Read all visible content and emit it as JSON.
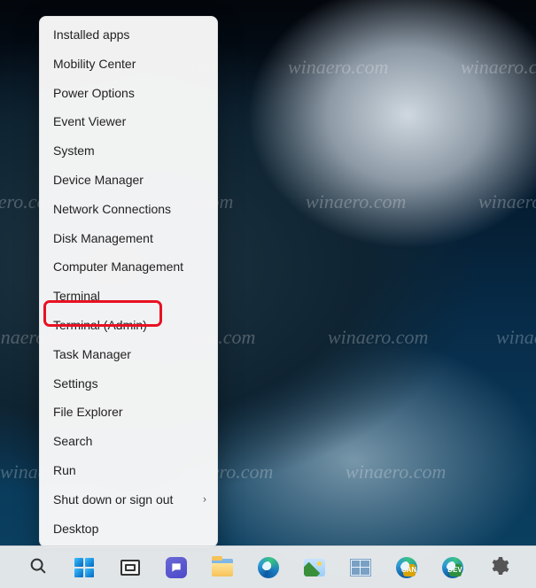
{
  "watermark_text": "winaero.com",
  "menu": {
    "items": [
      {
        "label": "Installed apps"
      },
      {
        "label": "Mobility Center"
      },
      {
        "label": "Power Options"
      },
      {
        "label": "Event Viewer"
      },
      {
        "label": "System"
      },
      {
        "label": "Device Manager"
      },
      {
        "label": "Network Connections"
      },
      {
        "label": "Disk Management"
      },
      {
        "label": "Computer Management"
      },
      {
        "label": "Terminal"
      },
      {
        "label": "Terminal (Admin)",
        "highlighted": true
      },
      {
        "label": "Task Manager"
      },
      {
        "label": "Settings"
      },
      {
        "label": "File Explorer"
      },
      {
        "label": "Search"
      },
      {
        "label": "Run"
      },
      {
        "label": "Shut down or sign out",
        "submenu": true
      },
      {
        "label": "Desktop"
      }
    ]
  },
  "taskbar": {
    "items": [
      {
        "name": "search-button",
        "kind": "search"
      },
      {
        "name": "start-button",
        "kind": "start"
      },
      {
        "name": "task-view-button",
        "kind": "taskview"
      },
      {
        "name": "chat-button",
        "kind": "chat"
      },
      {
        "name": "file-explorer-button",
        "kind": "explorer"
      },
      {
        "name": "edge-button",
        "kind": "edge"
      },
      {
        "name": "photos-button",
        "kind": "photos"
      },
      {
        "name": "app-button-1",
        "kind": "tiles"
      },
      {
        "name": "edge-canary-button",
        "kind": "edge",
        "badge": "CAN",
        "badge_color": "#d9a300"
      },
      {
        "name": "edge-dev-button",
        "kind": "edge",
        "badge": "DEV",
        "badge_color": "#2e8f3e"
      },
      {
        "name": "settings-button",
        "kind": "gear"
      }
    ]
  }
}
